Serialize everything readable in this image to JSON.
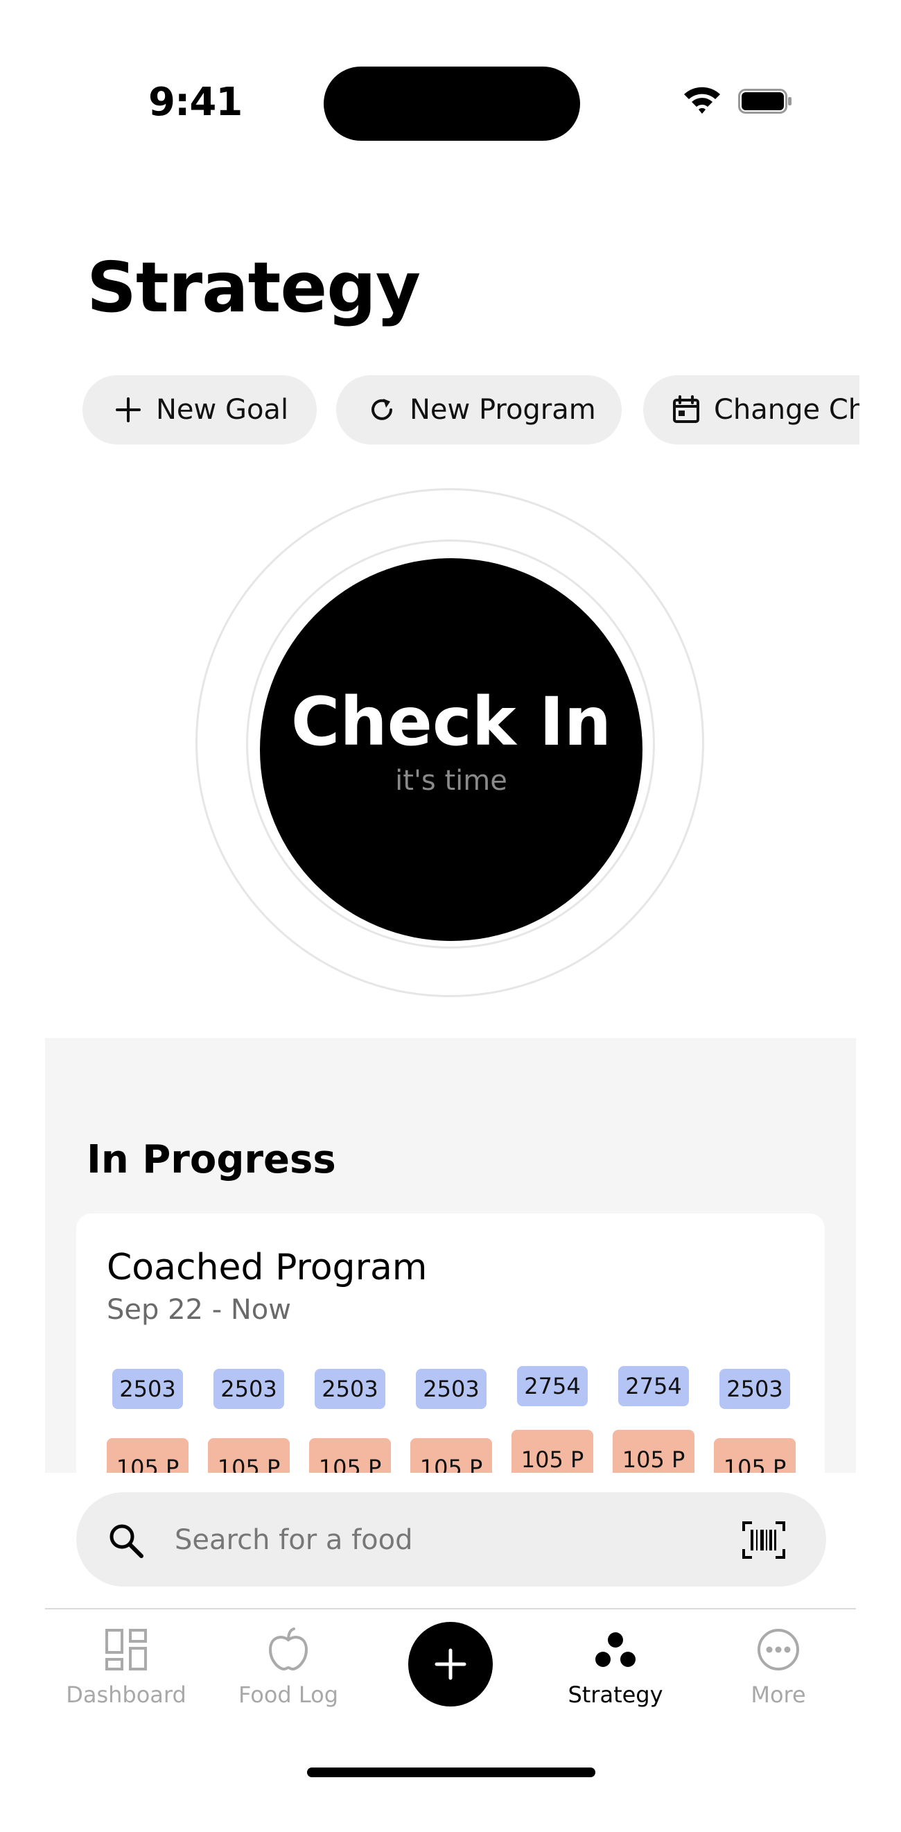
{
  "status_bar": {
    "time": "9:41"
  },
  "header": {
    "title": "Strategy"
  },
  "actions": {
    "new_goal": "New Goal",
    "new_program": "New Program",
    "change_check_in": "Change Check-In"
  },
  "check_in": {
    "label": "Check In",
    "sublabel": "it's time"
  },
  "in_progress": {
    "title": "In Progress",
    "program": {
      "name": "Coached Program",
      "dates": "Sep 22 - Now",
      "calories": [
        "2503",
        "2503",
        "2503",
        "2503",
        "2754",
        "2754",
        "2503"
      ],
      "protein": [
        "105 P",
        "105 P",
        "105 P",
        "105 P",
        "105 P",
        "105 P",
        "105 P"
      ]
    }
  },
  "search": {
    "placeholder": "Search for a food"
  },
  "tabs": [
    {
      "label": "Dashboard"
    },
    {
      "label": "Food Log"
    },
    {
      "label": "Strategy"
    },
    {
      "label": "More"
    }
  ]
}
